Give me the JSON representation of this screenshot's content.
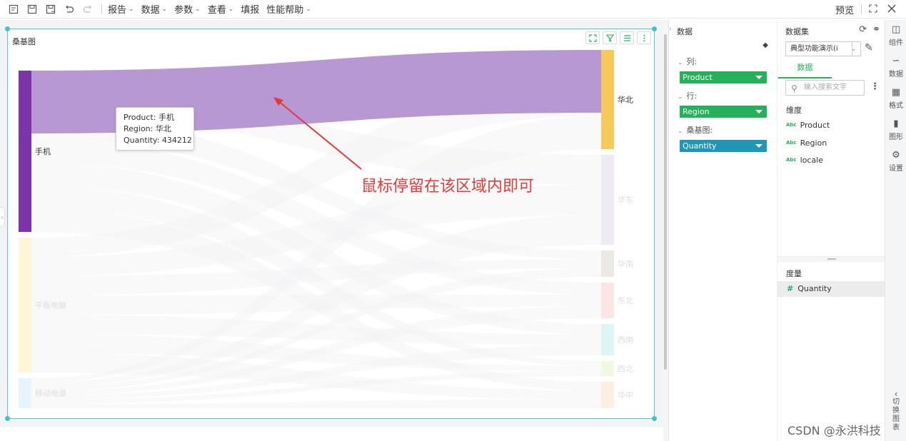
{
  "toolbar": {
    "menus": [
      "报告",
      "数据",
      "参数",
      "查看",
      "填报",
      "性能帮助"
    ],
    "preview_label": "预览"
  },
  "widget": {
    "title": "桑基图"
  },
  "tooltip": {
    "product": "Product:  手机",
    "region": "Region:    华北",
    "quantity": "Quantity: 434212"
  },
  "annotation": {
    "text": "鼠标停留在该区域内即可"
  },
  "chart_data": {
    "type": "sankey",
    "sources": [
      "手机",
      "平板电脑",
      "移动电源"
    ],
    "targets": [
      "华北",
      "华东",
      "华南",
      "东北",
      "西南",
      "西北",
      "华中"
    ],
    "highlighted_link": {
      "source": "手机",
      "target": "华北",
      "value": 434212
    },
    "colors": {
      "手机": "#7b35a8",
      "平板电脑": "#fff6d8",
      "移动电源": "#e8f4fb",
      "华北": "#f7c85a",
      "华东": "#eeebf5",
      "华南": "#ece8e4",
      "东北": "#fbe6e6",
      "西南": "#def5f5",
      "西北": "#f1f8e0",
      "华中": "#fdeee2",
      "link_highlight": "#b898d2"
    }
  },
  "data_panel": {
    "title": "数据",
    "columns_label": "列:",
    "columns_field": "Product",
    "rows_label": "行:",
    "rows_field": "Region",
    "sankey_label": "桑基图:",
    "sankey_field": "Quantity"
  },
  "dataset_panel": {
    "title": "数据集",
    "selected_dataset": "典型功能演示(i",
    "tab_label": "数据",
    "search_placeholder": "输入搜索文字",
    "dimension_header": "维度",
    "dimensions": [
      "Product",
      "Region",
      "locale"
    ],
    "measure_header": "度量",
    "measures": [
      "Quantity"
    ],
    "watermark": "CSDN @永洪科技"
  },
  "rail": {
    "items": [
      "组件",
      "数据",
      "格式",
      "图形",
      "设置"
    ],
    "switch_label": "切换图表"
  }
}
